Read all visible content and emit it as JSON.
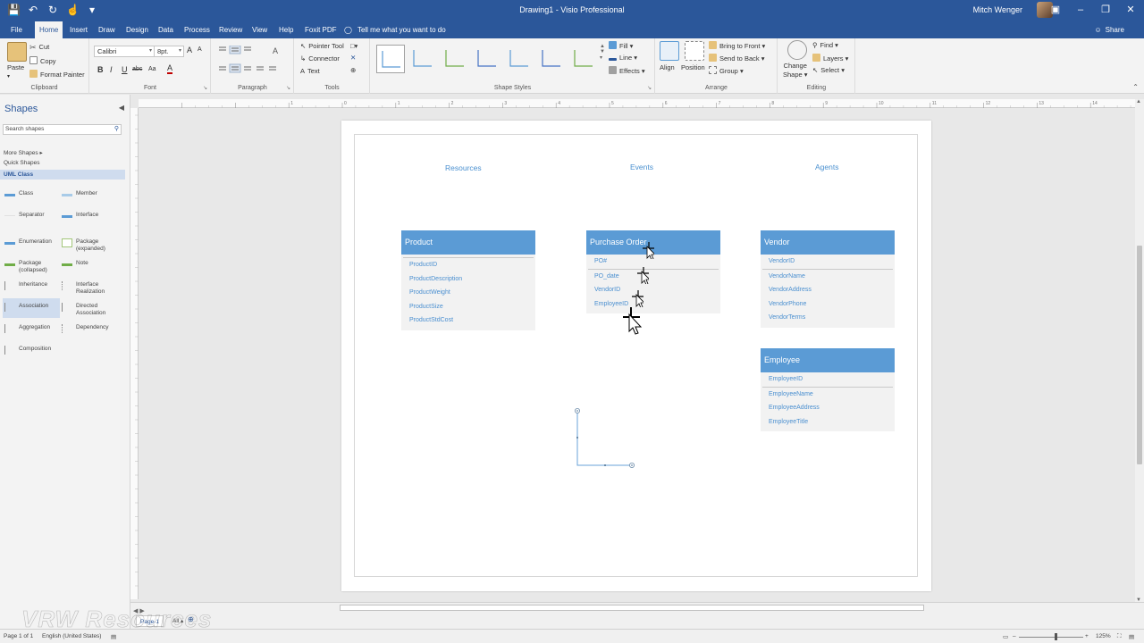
{
  "window": {
    "title": "Drawing1  -  Visio Professional",
    "user": "Mitch Wenger"
  },
  "tabs": [
    "File",
    "Home",
    "Insert",
    "Draw",
    "Design",
    "Data",
    "Process",
    "Review",
    "View",
    "Help",
    "Foxit PDF"
  ],
  "active_tab": "Home",
  "tell_me": "Tell me what you want to do",
  "share": "Share",
  "ribbon": {
    "clipboard": {
      "label": "Clipboard",
      "paste": "Paste",
      "cut": "Cut",
      "copy": "Copy",
      "format_painter": "Format Painter"
    },
    "font": {
      "label": "Font",
      "family": "Calibri",
      "size": "8pt.",
      "bold": "B",
      "italic": "I",
      "underline": "U",
      "strike": "abc",
      "case": "Aa",
      "color": "A",
      "grow": "A",
      "shrink": "A"
    },
    "paragraph": {
      "label": "Paragraph"
    },
    "tools": {
      "label": "Tools",
      "pointer": "Pointer Tool",
      "connector": "Connector",
      "text": "Text"
    },
    "shape_styles": {
      "label": "Shape Styles",
      "fill": "Fill",
      "line": "Line",
      "effects": "Effects"
    },
    "arrange": {
      "label": "Arrange",
      "align": "Align",
      "position": "Position",
      "bring_front": "Bring to Front",
      "send_back": "Send to Back",
      "group": "Group"
    },
    "editing": {
      "label": "Editing",
      "change_shape_1": "Change",
      "change_shape_2": "Shape",
      "find": "Find",
      "layers": "Layers",
      "select": "Select"
    }
  },
  "shapes_panel": {
    "title": "Shapes",
    "search_placeholder": "Search shapes",
    "more_shapes": "More Shapes",
    "quick_shapes": "Quick Shapes",
    "stencil": "UML Class",
    "items": [
      {
        "label": "Class",
        "color": "#5b9bd5"
      },
      {
        "label": "Member",
        "color": "#a8cbe8"
      },
      {
        "label": "Separator",
        "color": "#d0d0d0"
      },
      {
        "label": "Interface",
        "color": "#5b9bd5"
      },
      {
        "label": "Enumeration",
        "color": "#5b9bd5"
      },
      {
        "label": "Package (expanded)",
        "color": "#a3c67a"
      },
      {
        "label": "Package (collapsed)",
        "color": "#70ad47"
      },
      {
        "label": "Note",
        "color": "#70ad47"
      },
      {
        "label": "Inheritance",
        "color": "#888888"
      },
      {
        "label": "Interface Realization",
        "color": "#888888"
      },
      {
        "label": "Association",
        "color": "#888888"
      },
      {
        "label": "Directed Association",
        "color": "#888888"
      },
      {
        "label": "Aggregation",
        "color": "#888888"
      },
      {
        "label": "Dependency",
        "color": "#888888"
      },
      {
        "label": "Composition",
        "color": "#888888"
      }
    ],
    "selected": "Association"
  },
  "ruler_labels": [
    "1",
    "0",
    "1",
    "2",
    "3",
    "4",
    "5",
    "6",
    "7",
    "8",
    "9",
    "10",
    "11",
    "12",
    "13",
    "14",
    "15"
  ],
  "diagram": {
    "column_labels": [
      "Resources",
      "Events",
      "Agents"
    ],
    "classes": [
      {
        "title": "Product",
        "first": "ProductID",
        "attrs": [
          "ProductDescription",
          "ProductWeight",
          "ProductSize",
          "ProductStdCost"
        ]
      },
      {
        "title": "Purchase Order",
        "first": "PO#",
        "attrs": [
          "PO_date",
          "VendorID",
          "EmployeeID"
        ]
      },
      {
        "title": "Vendor",
        "first": "VendorID",
        "attrs": [
          "VendorName",
          "VendorAddress",
          "VendorPhone",
          "VendorTerms"
        ]
      },
      {
        "title": "Employee",
        "first": "EmployeeID",
        "attrs": [
          "EmployeeName",
          "EmployeeAddress",
          "EmployeeTitle"
        ]
      }
    ]
  },
  "page_tabs": {
    "page": "Page-1",
    "all": "All"
  },
  "status": {
    "page": "Page 1 of 1",
    "language": "English (United States)",
    "zoom": "125%"
  },
  "watermark": "VRW Resources"
}
